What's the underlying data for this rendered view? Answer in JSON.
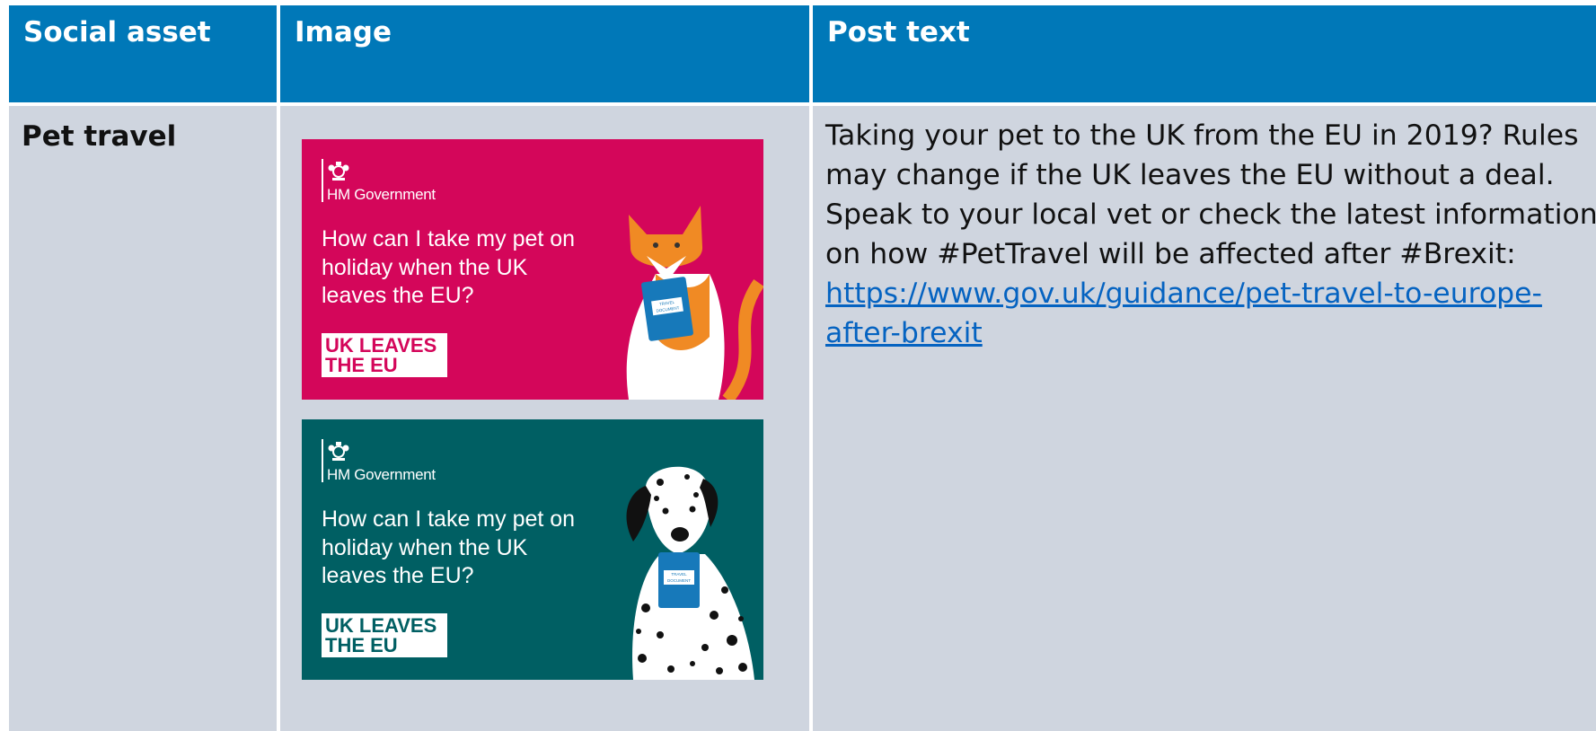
{
  "table": {
    "headers": [
      "Social asset",
      "Image",
      "Post text"
    ],
    "rows": [
      {
        "asset": "Pet travel",
        "images": [
          {
            "theme": "pink",
            "background": "#d4065a",
            "brand": "HM Government",
            "question": "How can I take my pet on holiday when the UK leaves the EU?",
            "badge_line1": "UK LEAVES",
            "badge_line2": "THE EU",
            "animal": "cat",
            "document_label_1": "TRAVEL",
            "document_label_2": "DOCUMENT"
          },
          {
            "theme": "teal",
            "background": "#005f63",
            "brand": "HM Government",
            "question": "How can I take my pet on holiday when the UK leaves the EU?",
            "badge_line1": "UK LEAVES",
            "badge_line2": "THE EU",
            "animal": "dalmatian",
            "document_label_1": "TRAVEL",
            "document_label_2": "DOCUMENT"
          }
        ],
        "post_text": "Taking your pet to the UK from the EU in 2019? Rules may change if the UK leaves the EU without a deal. Speak to your local vet or check the latest information on how #PetTravel will be affected after #Brexit:",
        "post_link": "https://www.gov.uk/guidance/pet-travel-to-europe-after-brexit"
      }
    ]
  },
  "colors": {
    "header_bg": "#0078b8",
    "cell_bg": "#cfd5df",
    "link": "#0563c1"
  }
}
